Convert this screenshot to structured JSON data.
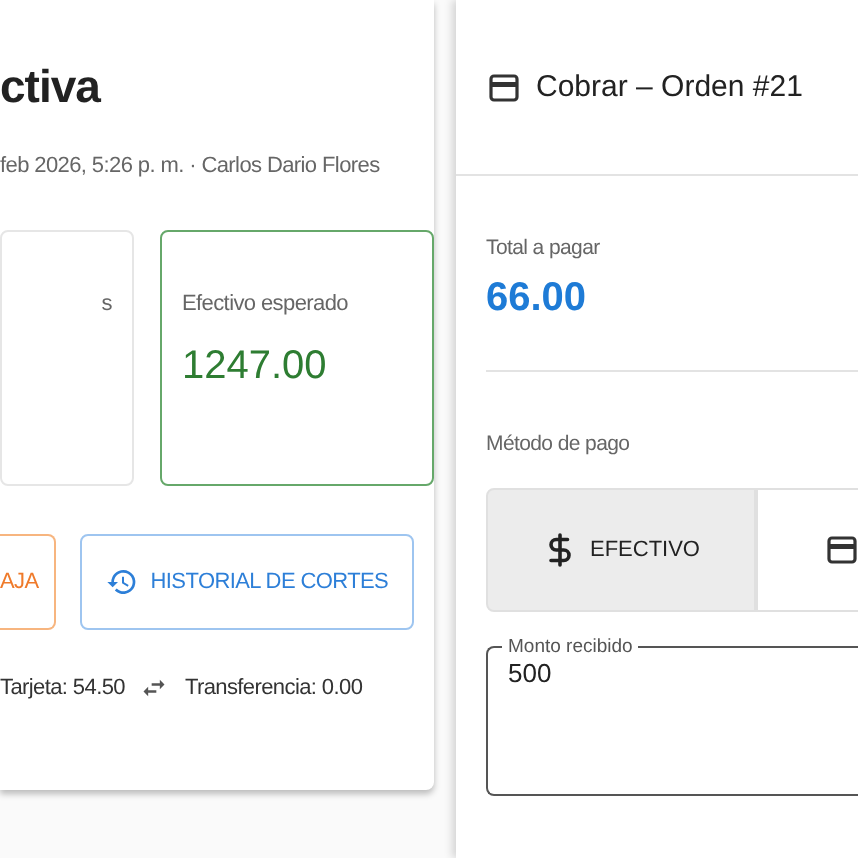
{
  "background_page": {
    "title": "ctiva",
    "subtitle": "feb 2026, 5:26 p. m. · Carlos Dario Flores",
    "stats": [
      {
        "label": "s",
        "highlighted": false
      },
      {
        "label": "Efectivo esperado",
        "value": "1247.00",
        "highlighted": true
      }
    ],
    "buttons": [
      {
        "label": "AJA",
        "kind": "warning"
      },
      {
        "label": "HISTORIAL DE CORTES",
        "kind": "history"
      }
    ],
    "totals": [
      {
        "text": "Tarjeta: 54.50",
        "kind": "plain"
      },
      {
        "text": "Transferencia: 0.00",
        "kind": "transfer"
      }
    ]
  },
  "dialog": {
    "title": "Cobrar – Orden #21",
    "total_label": "Total a pagar",
    "total": "66.00",
    "method_label": "Método de pago",
    "methods": [
      {
        "label": "EFECTIVO",
        "kind": "cash",
        "selected": true
      },
      {
        "kind": "card",
        "selected": false
      }
    ],
    "amount_field": {
      "label": "Monto recibido",
      "value": "500"
    }
  }
}
